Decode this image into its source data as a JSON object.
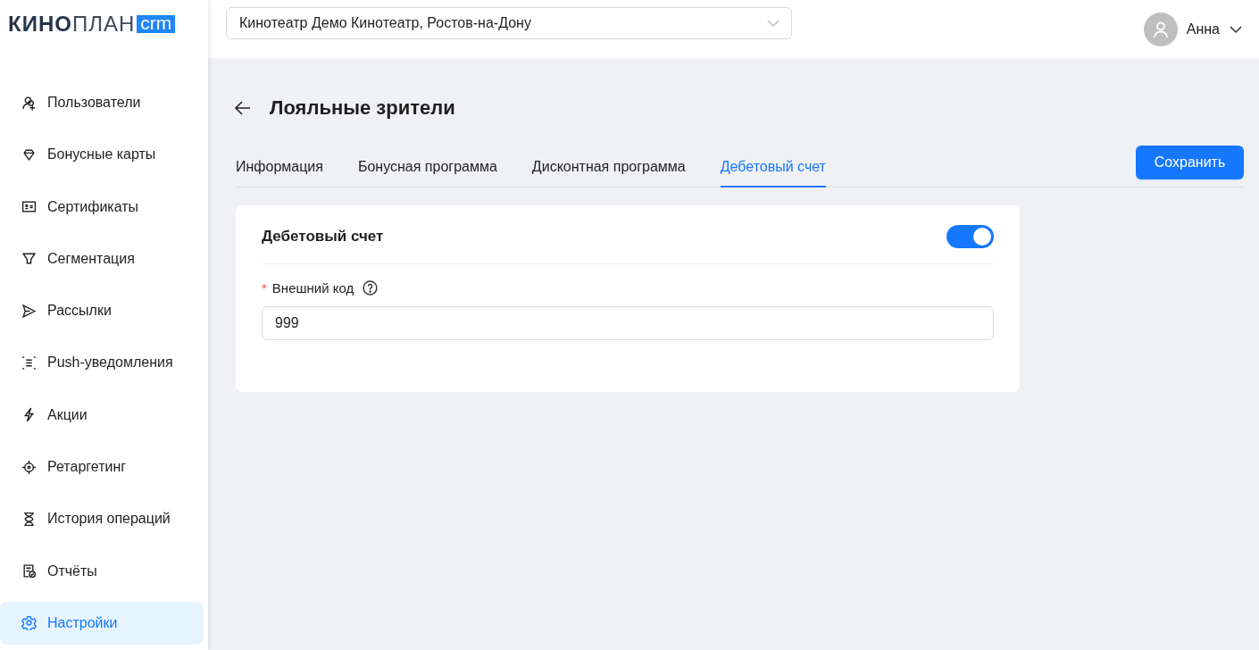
{
  "logo": {
    "bold": "КИНО",
    "light": "ПЛАН",
    "badge": "crm"
  },
  "sidebar": {
    "items": [
      {
        "label": "Пользователи",
        "selected": false
      },
      {
        "label": "Бонусные карты",
        "selected": false
      },
      {
        "label": "Сертификаты",
        "selected": false
      },
      {
        "label": "Сегментация",
        "selected": false
      },
      {
        "label": "Рассылки",
        "selected": false
      },
      {
        "label": "Push-уведомления",
        "selected": false
      },
      {
        "label": "Акции",
        "selected": false
      },
      {
        "label": "Ретаргетинг",
        "selected": false
      },
      {
        "label": "История операций",
        "selected": false
      },
      {
        "label": "Отчёты",
        "selected": false
      },
      {
        "label": "Настройки",
        "selected": true
      }
    ]
  },
  "header": {
    "cinema_select": {
      "value": "Кинотеатр Демо Кинотеатр, Ростов-на-Дону"
    },
    "user": {
      "name": "Анна"
    }
  },
  "page": {
    "title": "Лояльные зрители",
    "tabs": [
      {
        "label": "Информация",
        "selected": false
      },
      {
        "label": "Бонусная программа",
        "selected": false
      },
      {
        "label": "Дисконтная программа",
        "selected": false
      },
      {
        "label": "Дебетовый счет",
        "selected": true
      }
    ],
    "save_button": "Сохранить",
    "card": {
      "title": "Дебетовый счет",
      "enabled": true,
      "field": {
        "required_mark": "*",
        "label": "Внешний код",
        "value": "999"
      }
    }
  }
}
